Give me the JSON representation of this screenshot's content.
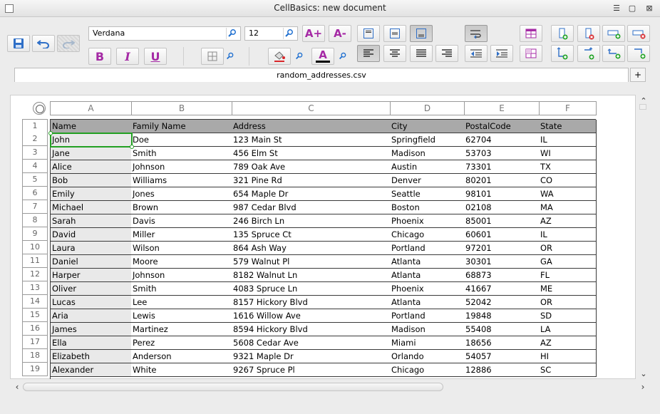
{
  "window": {
    "title": "CellBasics: new document"
  },
  "toolbar": {
    "font_name": "Verdana",
    "font_size": "12",
    "bold_label": "B",
    "italic_label": "I",
    "underline_label": "U",
    "grow_font_label": "A+",
    "shrink_font_label": "A-",
    "font_color_label": "A"
  },
  "file": {
    "tab_name": "random_addresses.csv",
    "add_tab_label": "+"
  },
  "sheet": {
    "columns": [
      "A",
      "B",
      "C",
      "D",
      "E",
      "F"
    ],
    "row_numbers": [
      "1",
      "2",
      "3",
      "4",
      "5",
      "6",
      "7",
      "8",
      "9",
      "10",
      "11",
      "12",
      "13",
      "14",
      "15",
      "16",
      "17",
      "18",
      "19"
    ],
    "rows": [
      [
        "Name",
        "Family Name",
        "Address",
        "City",
        "PostalCode",
        "State"
      ],
      [
        "John",
        "Doe",
        "123 Main St",
        "Springfield",
        "62704",
        "IL"
      ],
      [
        "Jane",
        "Smith",
        "456 Elm St",
        "Madison",
        "53703",
        "WI"
      ],
      [
        "Alice",
        "Johnson",
        "789 Oak Ave",
        "Austin",
        "73301",
        "TX"
      ],
      [
        "Bob",
        "Williams",
        "321 Pine Rd",
        "Denver",
        "80201",
        "CO"
      ],
      [
        "Emily",
        "Jones",
        "654 Maple Dr",
        "Seattle",
        "98101",
        "WA"
      ],
      [
        "Michael",
        "Brown",
        "987 Cedar Blvd",
        "Boston",
        "02108",
        "MA"
      ],
      [
        "Sarah",
        "Davis",
        "246 Birch Ln",
        "Phoenix",
        "85001",
        "AZ"
      ],
      [
        "David",
        "Miller",
        "135 Spruce Ct",
        "Chicago",
        "60601",
        "IL"
      ],
      [
        "Laura",
        "Wilson",
        "864 Ash Way",
        "Portland",
        "97201",
        "OR"
      ],
      [
        "Daniel",
        "Moore",
        "579 Walnut Pl",
        "Atlanta",
        "30301",
        "GA"
      ],
      [
        "Harper",
        "Johnson",
        "8182 Walnut Ln",
        "Atlanta",
        "68873",
        "FL"
      ],
      [
        "Oliver",
        "Smith",
        "4083 Spruce Ln",
        "Phoenix",
        "41667",
        "ME"
      ],
      [
        "Lucas",
        "Lee",
        "8157 Hickory Blvd",
        "Atlanta",
        "52042",
        "OR"
      ],
      [
        "Aria",
        "Lewis",
        "1616 Willow Ave",
        "Portland",
        "19848",
        "SD"
      ],
      [
        "James",
        "Martinez",
        "8594 Hickory Blvd",
        "Madison",
        "55408",
        "LA"
      ],
      [
        "Ella",
        "Perez",
        "5608 Cedar Ave",
        "Miami",
        "18656",
        "AZ"
      ],
      [
        "Elizabeth",
        "Anderson",
        "9321 Maple Dr",
        "Orlando",
        "54057",
        "HI"
      ],
      [
        "Alexander",
        "White",
        "9267 Spruce Pl",
        "Chicago",
        "12886",
        "SC"
      ]
    ],
    "selected_cell": "A2"
  },
  "colors": {
    "selection": "#22a022",
    "header_row": "#a9a9a9",
    "column_a": "#e9e9e9",
    "accent": "#1e6fd0"
  }
}
